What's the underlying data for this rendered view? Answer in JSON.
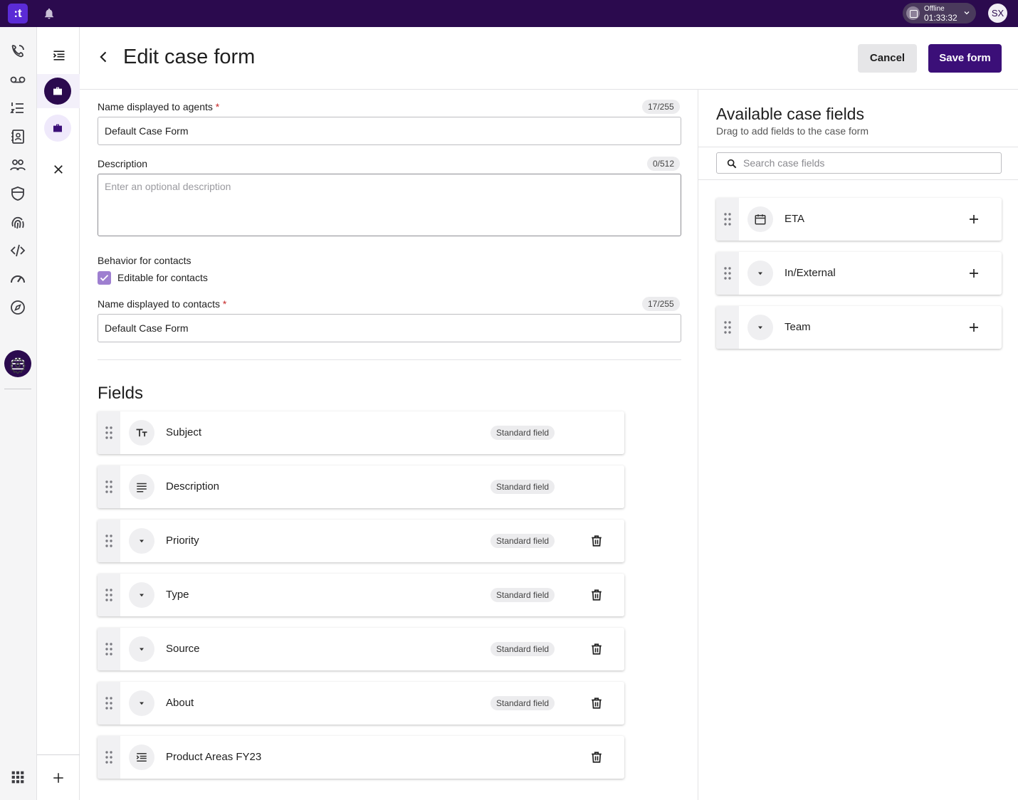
{
  "topbar": {
    "logo": ":t",
    "status_label": "Offline",
    "status_time": "01:33:32",
    "avatar_initials": "SX"
  },
  "header": {
    "title": "Edit case form",
    "cancel_label": "Cancel",
    "save_label": "Save form"
  },
  "form": {
    "agent_name_label": "Name displayed to agents",
    "agent_name_required": "*",
    "agent_name_count": "17/255",
    "agent_name_value": "Default Case Form",
    "description_label": "Description",
    "description_count": "0/512",
    "description_placeholder": "Enter an optional description",
    "behavior_label": "Behavior for contacts",
    "editable_label": "Editable for contacts",
    "editable_checked": true,
    "contact_name_label": "Name displayed to contacts",
    "contact_name_required": "*",
    "contact_name_count": "17/255",
    "contact_name_value": "Default Case Form"
  },
  "fields": {
    "title": "Fields",
    "items": [
      {
        "name": "Subject",
        "icon": "text-format-icon",
        "badge": "Standard field",
        "deletable": false
      },
      {
        "name": "Description",
        "icon": "paragraph-icon",
        "badge": "Standard field",
        "deletable": false
      },
      {
        "name": "Priority",
        "icon": "dropdown-icon",
        "badge": "Standard field",
        "deletable": true
      },
      {
        "name": "Type",
        "icon": "dropdown-icon",
        "badge": "Standard field",
        "deletable": true
      },
      {
        "name": "Source",
        "icon": "dropdown-icon",
        "badge": "Standard field",
        "deletable": true
      },
      {
        "name": "About",
        "icon": "dropdown-icon",
        "badge": "Standard field",
        "deletable": true
      },
      {
        "name": "Product Areas FY23",
        "icon": "tree-select-icon",
        "badge": "",
        "deletable": true
      }
    ]
  },
  "panel": {
    "title": "Available case fields",
    "subtitle": "Drag to add fields to the case form",
    "search_placeholder": "Search case fields",
    "items": [
      {
        "name": "ETA",
        "icon": "calendar-icon"
      },
      {
        "name": "In/External",
        "icon": "dropdown-icon"
      },
      {
        "name": "Team",
        "icon": "dropdown-icon"
      }
    ]
  },
  "colors": {
    "topbar": "#2b0a4e",
    "primary_button": "#3b0f78",
    "checkbox": "#9e7fd0",
    "required": "#c62828"
  }
}
